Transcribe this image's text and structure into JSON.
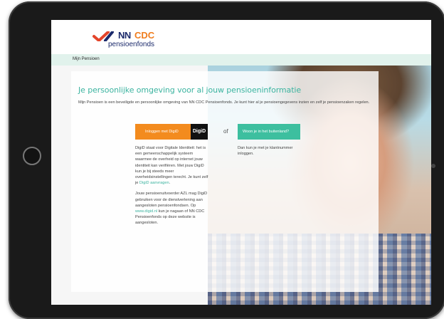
{
  "logo": {
    "nn": "NN",
    "cdc": "CDC",
    "sub": "pensioenfonds",
    "color_primary": "#1b2a6b",
    "color_accent": "#f07d1e",
    "check_color": "#e4452b"
  },
  "nav": {
    "items": [
      {
        "label": "Mijn Pensioen"
      }
    ]
  },
  "main": {
    "title": "Je persoonlijke omgeving voor al jouw pensioeninformatie",
    "intro": "Mijn Pensioen is een beveiligde en persoonlijke omgeving van NN CDC Pensioenfonds. Je kunt hier al je pensioengegevens inzien en zelf je pensioenzaken regelen.",
    "digid_button": "Inloggen met DigiD",
    "digid_logo": "DigiD",
    "or": "of",
    "abroad_button": "Woon je in het buitenland?",
    "left_col": {
      "p1_text": "DigiD staat voor Digitale Identiteit: het is een gemeenschappelijk systeem waarmee de overheid op internet jouw identiteit kan verifiëren. Met jouw DigiD kun je bij steeds meer overheidsinstellingen terecht. Je kunt zelf je ",
      "p1_link": "DigiD aanvragen",
      "p1_end": ".",
      "p2_text": "Jouw pensioenuitvoerder AZL mag DigiD gebruiken voor de dienstverlening aan aangesloten pensioenfondsen. Op ",
      "p2_link": "www.digid.nl",
      "p2_end": " kun je nagaan of NN CDC Pensioenfonds op deze website is aangesloten."
    },
    "right_col": "Dan kun je met je klantnummer inloggen.",
    "colors": {
      "accent": "#3cb4a0",
      "digid_orange": "#f38b1e",
      "abroad_green": "#3dbf9f"
    }
  }
}
